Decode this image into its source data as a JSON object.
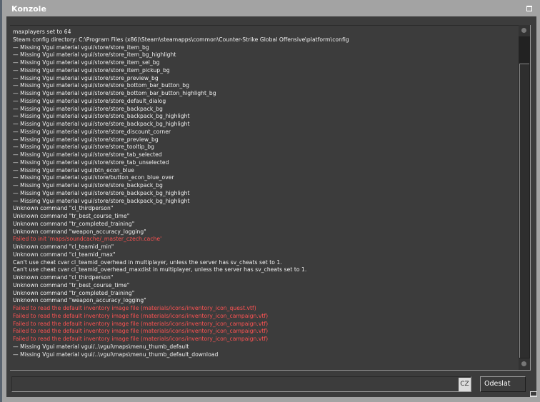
{
  "window": {
    "title": "Konzole"
  },
  "console": {
    "lines": [
      {
        "text": "maxplayers set to 64",
        "type": "normal"
      },
      {
        "text": "Steam config directory: C:\\Program Files (x86)\\Steam\\steamapps\\common\\Counter-Strike Global Offensive\\platform\\config",
        "type": "normal"
      },
      {
        "text": "— Missing Vgui material vgui/store/store_item_bg",
        "type": "normal"
      },
      {
        "text": "— Missing Vgui material vgui/store/store_item_bg_highlight",
        "type": "normal"
      },
      {
        "text": "— Missing Vgui material vgui/store/store_item_sel_bg",
        "type": "normal"
      },
      {
        "text": "— Missing Vgui material vgui/store/store_item_pickup_bg",
        "type": "normal"
      },
      {
        "text": "— Missing Vgui material vgui/store/store_preview_bg",
        "type": "normal"
      },
      {
        "text": "— Missing Vgui material vgui/store/store_bottom_bar_button_bg",
        "type": "normal"
      },
      {
        "text": "— Missing Vgui material vgui/store/store_bottom_bar_button_highlight_bg",
        "type": "normal"
      },
      {
        "text": "— Missing Vgui material vgui/store/store_default_dialog",
        "type": "normal"
      },
      {
        "text": "— Missing Vgui material vgui/store/store_backpack_bg",
        "type": "normal"
      },
      {
        "text": "— Missing Vgui material vgui/store/store_backpack_bg_highlight",
        "type": "normal"
      },
      {
        "text": "— Missing Vgui material vgui/store/store_backpack_bg_highlight",
        "type": "normal"
      },
      {
        "text": "— Missing Vgui material vgui/store/store_discount_corner",
        "type": "normal"
      },
      {
        "text": "— Missing Vgui material vgui/store/store_preview_bg",
        "type": "normal"
      },
      {
        "text": "— Missing Vgui material vgui/store/store_tooltip_bg",
        "type": "normal"
      },
      {
        "text": "— Missing Vgui material vgui/store/store_tab_selected",
        "type": "normal"
      },
      {
        "text": "— Missing Vgui material vgui/store/store_tab_unselected",
        "type": "normal"
      },
      {
        "text": "— Missing Vgui material vgui/btn_econ_blue",
        "type": "normal"
      },
      {
        "text": "— Missing Vgui material vgui/store/button_econ_blue_over",
        "type": "normal"
      },
      {
        "text": "— Missing Vgui material vgui/store/store_backpack_bg",
        "type": "normal"
      },
      {
        "text": "— Missing Vgui material vgui/store/store_backpack_bg_highlight",
        "type": "normal"
      },
      {
        "text": "— Missing Vgui material vgui/store/store_backpack_bg_highlight",
        "type": "normal"
      },
      {
        "text": "Unknown command \"cl_thirdperson\"",
        "type": "normal"
      },
      {
        "text": "Unknown command \"tr_best_course_time\"",
        "type": "normal"
      },
      {
        "text": "Unknown command \"tr_completed_training\"",
        "type": "normal"
      },
      {
        "text": "Unknown command \"weapon_accuracy_logging\"",
        "type": "normal"
      },
      {
        "text": "Failed to init 'maps/soundcache/_master_czech.cache'",
        "type": "error"
      },
      {
        "text": "Unknown command \"cl_teamid_min\"",
        "type": "normal"
      },
      {
        "text": "Unknown command \"cl_teamid_max\"",
        "type": "normal"
      },
      {
        "text": "Can't use cheat cvar cl_teamid_overhead in multiplayer, unless the server has sv_cheats set to 1.",
        "type": "normal"
      },
      {
        "text": "Can't use cheat cvar cl_teamid_overhead_maxdist in multiplayer, unless the server has sv_cheats set to 1.",
        "type": "normal"
      },
      {
        "text": "Unknown command \"cl_thirdperson\"",
        "type": "normal"
      },
      {
        "text": "Unknown command \"tr_best_course_time\"",
        "type": "normal"
      },
      {
        "text": "Unknown command \"tr_completed_training\"",
        "type": "normal"
      },
      {
        "text": "Unknown command \"weapon_accuracy_logging\"",
        "type": "normal"
      },
      {
        "text": "Failed to read the default inventory image file (materials/icons/inventory_icon_quest.vtf)",
        "type": "error"
      },
      {
        "text": "Failed to read the default inventory image file (materials/icons/inventory_icon_campaign.vtf)",
        "type": "error"
      },
      {
        "text": "Failed to read the default inventory image file (materials/icons/inventory_icon_campaign.vtf)",
        "type": "error"
      },
      {
        "text": "Failed to read the default inventory image file (materials/icons/inventory_icon_campaign.vtf)",
        "type": "error"
      },
      {
        "text": "Failed to read the default inventory image file (materials/icons/inventory_icon_campaign.vtf)",
        "type": "error"
      },
      {
        "text": "— Missing Vgui material vgui/..\\vgui\\maps\\menu_thumb_default",
        "type": "normal"
      },
      {
        "text": "— Missing Vgui material vgui/..\\vgui\\maps\\menu_thumb_default_download",
        "type": "normal"
      }
    ]
  },
  "input": {
    "value": "",
    "language_badge": "CZ"
  },
  "send_button": {
    "label": "Odeslat"
  },
  "colors": {
    "error": "#ff5252",
    "normal": "#f2f2f2",
    "background": "#3c3c3c",
    "frame": "#a3a3a3"
  }
}
